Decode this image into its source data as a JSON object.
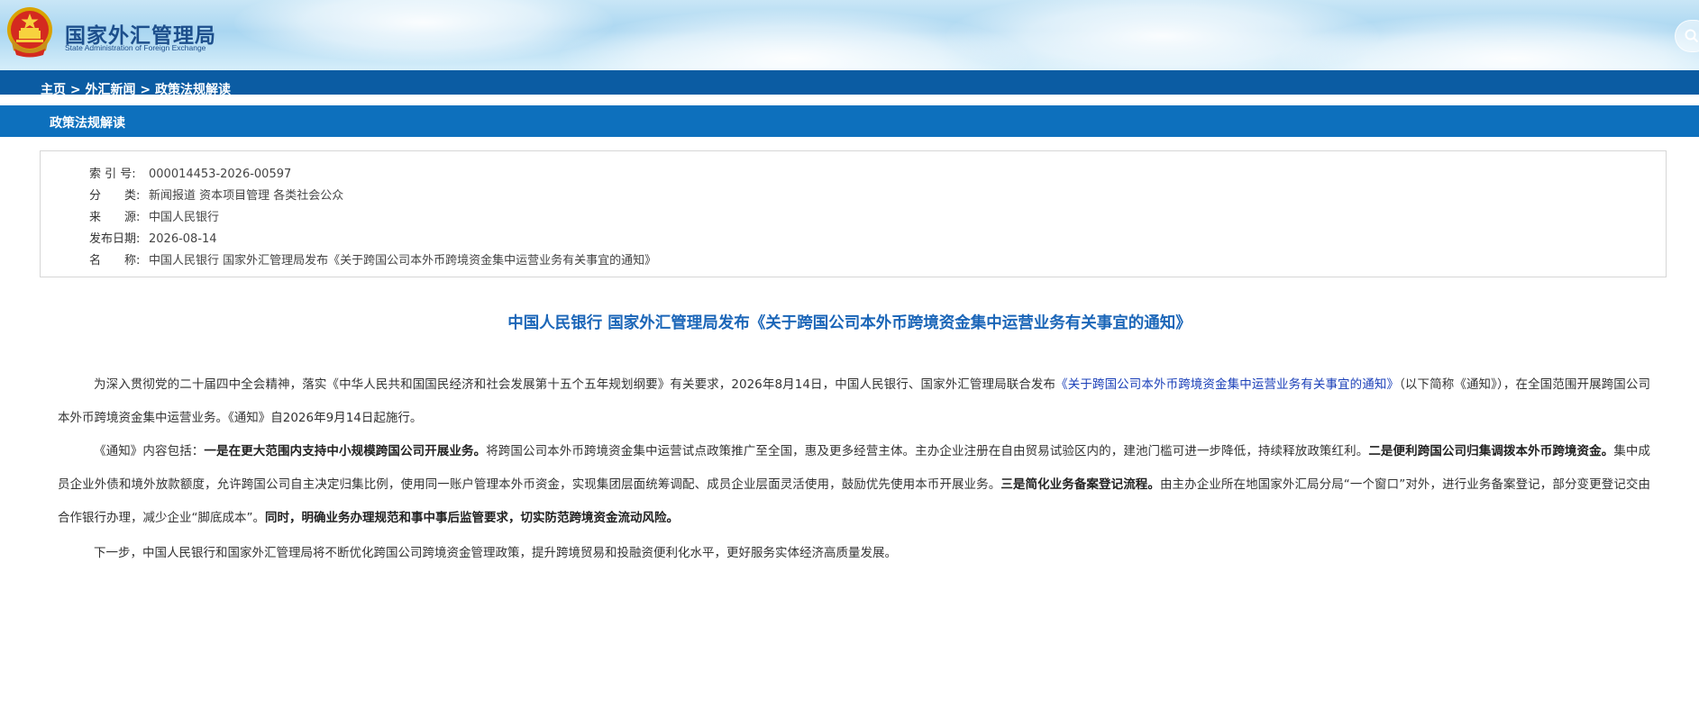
{
  "header": {
    "logo_cn": "国家外汇管理局",
    "logo_en": "State Administration of Foreign Exchange",
    "emblem_icon": "national-emblem-icon",
    "search_icon": "search-icon"
  },
  "breadcrumb": {
    "items": [
      "主页",
      "外汇新闻",
      "政策法规解读"
    ],
    "separator": ">"
  },
  "section": {
    "title": "政策法规解读"
  },
  "meta": [
    {
      "label": "索 引 号:",
      "value": "000014453-2026-00597"
    },
    {
      "label": "分　　类:",
      "value": "新闻报道  资本项目管理  各类社会公众"
    },
    {
      "label": "来　　源:",
      "value": "中国人民银行"
    },
    {
      "label": "发布日期:",
      "value": "2026-08-14"
    },
    {
      "label": "名　　称:",
      "value": "中国人民银行 国家外汇管理局发布《关于跨国公司本外币跨境资金集中运营业务有关事宜的通知》"
    }
  ],
  "article": {
    "title": "中国人民银行 国家外汇管理局发布《关于跨国公司本外币跨境资金集中运营业务有关事宜的通知》",
    "p1": {
      "a": "为深入贯彻党的二十届四中全会精神，落实《中华人民共和国国民经济和社会发展第十五个五年规划纲要》有关要求，2026年8月14日，中国人民银行、国家外汇管理局联合发布",
      "link": "《关于跨国公司本外币跨境资金集中运营业务有关事宜的通知》",
      "b": "（以下简称《通知》），在全国范围开展跨国公司本外币跨境资金集中运营业务。《通知》自2026年9月14日起施行。"
    },
    "p2": {
      "t1": "《通知》内容包括：",
      "b1": "一是在更大范围内支持中小规模跨国公司开展业务。",
      "t2": "将跨国公司本外币跨境资金集中运营试点政策推广至全国，惠及更多经营主体。主办企业注册在自由贸易试验区内的，建池门槛可进一步降低，持续释放政策红利。",
      "b2": "二是便利跨国公司归集调拨本外币跨境资金。",
      "t3": "集中成员企业外债和境外放款额度，允许跨国公司自主决定归集比例，使用同一账户管理本外币资金，实现集团层面统筹调配、成员企业层面灵活使用，鼓励优先使用本币开展业务。",
      "b3": "三是简化业务备案登记流程。",
      "t4": "由主办企业所在地国家外汇局分局“一个窗口”对外，进行业务备案登记，部分变更登记交由合作银行办理，减少企业“脚底成本”。",
      "b4": "同时，明确业务办理规范和事中事后监管要求，切实防范跨境资金流动风险。"
    },
    "p3": "下一步，中国人民银行和国家外汇管理局将不断优化跨国公司跨境资金管理政策，提升跨境贸易和投融资便利化水平，更好服务实体经济高质量发展。"
  }
}
